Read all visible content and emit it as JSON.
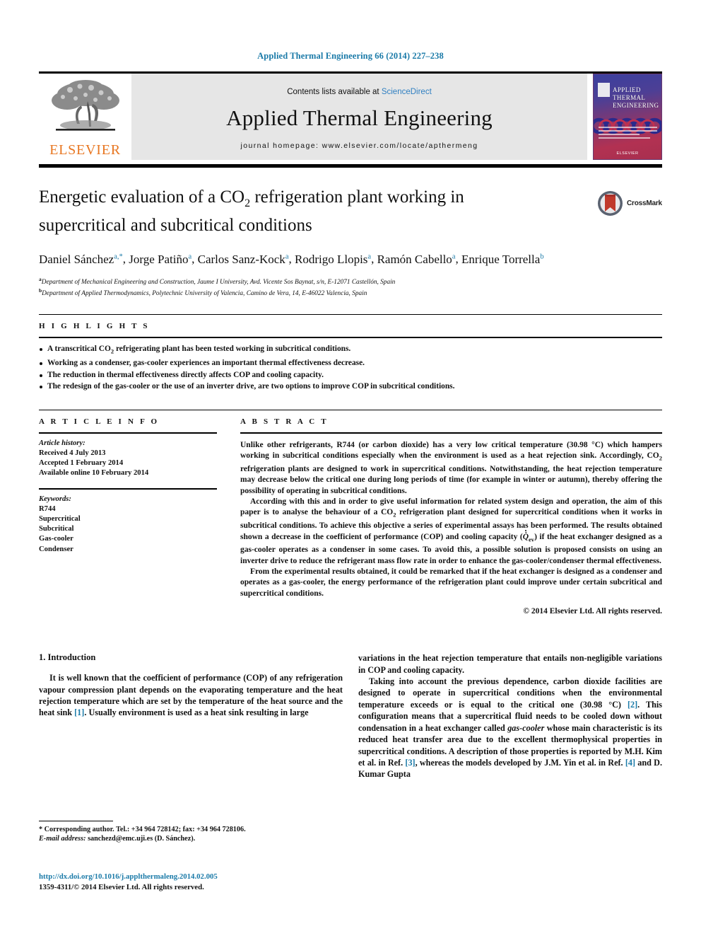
{
  "running_head": "Applied Thermal Engineering 66 (2014) 227–238",
  "masthead": {
    "publisher_name": "ELSEVIER",
    "contents_prefix": "Contents lists available at",
    "contents_link": "ScienceDirect",
    "journal_title": "Applied Thermal Engineering",
    "homepage": "journal homepage: www.elsevier.com/locate/apthermeng",
    "cover_title_lines": [
      "APPLIED",
      "THERMAL",
      "ENGINEERING"
    ],
    "cover_brand": "ELSEVIER",
    "accent_blue": "#1a7aa8",
    "elsevier_orange": "#e87722",
    "panel_gray": "#e6e6e6"
  },
  "article": {
    "title_line1": "Energetic evaluation of a CO",
    "title_sub": "2",
    "title_line1_rest": " refrigeration plant working in",
    "title_line2": "supercritical and subcritical conditions",
    "authors_html": "Daniel Sánchez, Jorge Patiño, Carlos Sanz-Kock, Rodrigo Llopis, Ramón Cabello, Enrique Torrella",
    "authors": [
      {
        "name": "Daniel Sánchez",
        "marks": "a,*"
      },
      {
        "name": "Jorge Patiño",
        "marks": "a"
      },
      {
        "name": "Carlos Sanz-Kock",
        "marks": "a"
      },
      {
        "name": "Rodrigo Llopis",
        "marks": "a"
      },
      {
        "name": "Ramón Cabello",
        "marks": "a"
      },
      {
        "name": "Enrique Torrella",
        "marks": "b"
      }
    ],
    "affiliations": [
      {
        "mark": "a",
        "text": "Department of Mechanical Engineering and Construction, Jaume I University, Avd. Vicente Sos Baynat, s/n, E-12071 Castellón, Spain"
      },
      {
        "mark": "b",
        "text": "Department of Applied Thermodynamics, Polytechnic University of Valencia, Camino de Vera, 14, E-46022 Valencia, Spain"
      }
    ],
    "crossmark_label": "CrossMark"
  },
  "highlights": {
    "heading": "H I G H L I G H T S",
    "items": [
      "A transcritical CO2 refrigerating plant has been tested working in subcritical conditions.",
      "Working as a condenser, gas-cooler experiences an important thermal effectiveness decrease.",
      "The reduction in thermal effectiveness directly affects COP and cooling capacity.",
      "The redesign of the gas-cooler or the use of an inverter drive, are two options to improve COP in subcritical conditions."
    ]
  },
  "article_info": {
    "heading": "A R T I C L E   I N F O",
    "history_label": "Article history:",
    "history": [
      "Received 4 July 2013",
      "Accepted 1 February 2014",
      "Available online 10 February 2014"
    ],
    "keywords_label": "Keywords:",
    "keywords": [
      "R744",
      "Supercritical",
      "Subcritical",
      "Gas-cooler",
      "Condenser"
    ]
  },
  "abstract": {
    "heading": "A B S T R A C T",
    "paragraph1": "Unlike other refrigerants, R744 (or carbon dioxide) has a very low critical temperature (30.98 °C) which hampers working in subcritical conditions especially when the environment is used as a heat rejection sink. Accordingly, CO2 refrigeration plants are designed to work in supercritical conditions. Notwithstanding, the heat rejection temperature may decrease below the critical one during long periods of time (for example in winter or autumn), thereby offering the possibility of operating in subcritical conditions.",
    "paragraph2": "According with this and in order to give useful information for related system design and operation, the aim of this paper is to analyse the behaviour of a CO2 refrigeration plant designed for supercritical conditions when it works in subcritical conditions. To achieve this objective a series of experimental assays has been performed. The results obtained shown a decrease in the coefficient of performance (COP) and cooling capacity (Q̇ev) if the heat exchanger designed as a gas-cooler operates as a condenser in some cases. To avoid this, a possible solution is proposed consists on using an inverter drive to reduce the refrigerant mass flow rate in order to enhance the gas-cooler/condenser thermal effectiveness.",
    "paragraph3": "From the experimental results obtained, it could be remarked that if the heat exchanger is designed as a condenser and operates as a gas-cooler, the energy performance of the refrigeration plant could improve under certain subcritical and supercritical conditions.",
    "copyright": "© 2014 Elsevier Ltd. All rights reserved."
  },
  "body": {
    "section_heading": "1. Introduction",
    "left_paragraph": "It is well known that the coefficient of performance (COP) of any refrigeration vapour compression plant depends on the evaporating temperature and the heat rejection temperature which are set by the temperature of the heat source and the heat sink [1]. Usually environment is used as a heat sink resulting in large",
    "right_paragraph_continued": "variations in the heat rejection temperature that entails non-negligible variations in COP and cooling capacity.",
    "right_paragraph2": "Taking into account the previous dependence, carbon dioxide facilities are designed to operate in supercritical conditions when the environmental temperature exceeds or is equal to the critical one (30.98 °C) [2]. This configuration means that a supercritical fluid needs to be cooled down without condensation in a heat exchanger called gas-cooler whose main characteristic is its reduced heat transfer area due to the excellent thermophysical properties in supercritical conditions. A description of those properties is reported by M.H. Kim et al. in Ref. [3], whereas the models developed by J.M. Yin et al. in Ref. [4] and D. Kumar Gupta"
  },
  "footnote": {
    "corresponding": "* Corresponding author. Tel.: +34 964 728142; fax: +34 964 728106.",
    "email_label": "E-mail address:",
    "email": "sanchezd@emc.uji.es",
    "email_owner": "(D. Sánchez)."
  },
  "publisher_footer": {
    "doi": "http://dx.doi.org/10.1016/j.applthermaleng.2014.02.005",
    "issn_line": "1359-4311/© 2014 Elsevier Ltd. All rights reserved."
  }
}
